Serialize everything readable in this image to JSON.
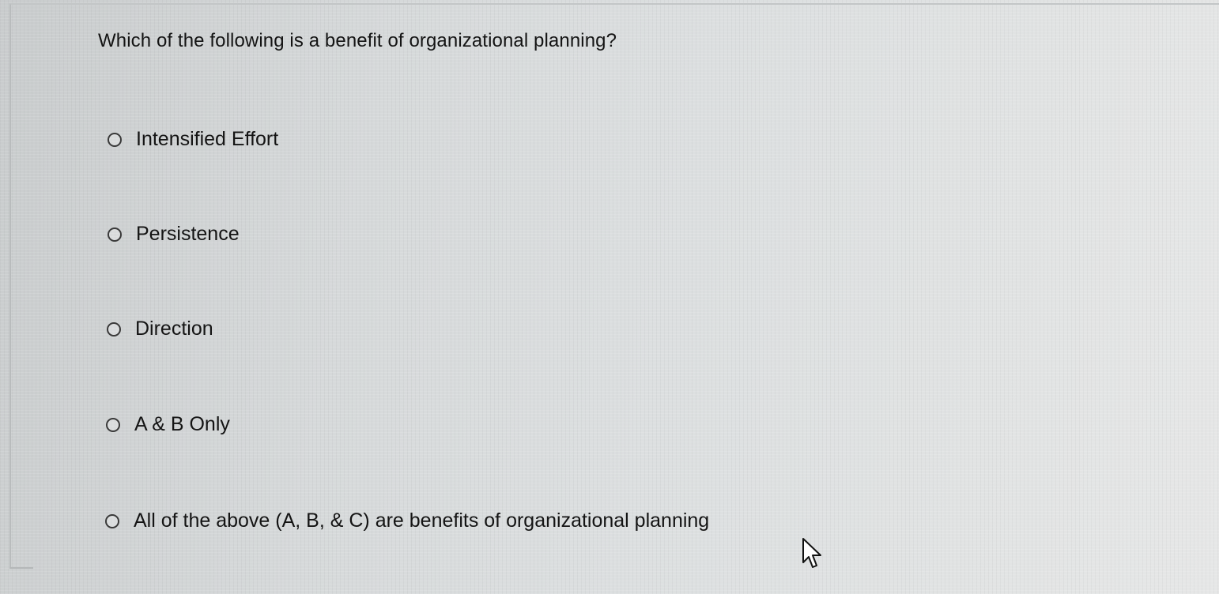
{
  "question": {
    "text": "Which of the following is a benefit of organizational planning?"
  },
  "choices": [
    {
      "label": "Intensified Effort",
      "selected": false
    },
    {
      "label": "Persistence",
      "selected": false
    },
    {
      "label": "Direction",
      "selected": false
    },
    {
      "label": "A & B Only",
      "selected": false
    },
    {
      "label": "All of the above (A, B, & C) are benefits of organizational planning",
      "selected": false
    }
  ],
  "icons": {
    "radio": "radio-button-unselected-icon",
    "cursor": "mouse-pointer-icon"
  },
  "colors": {
    "text": "#141414",
    "radio_border": "#3a3a3a"
  }
}
